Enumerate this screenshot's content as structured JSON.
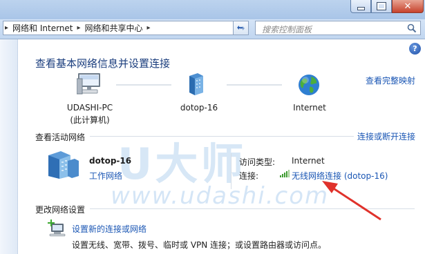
{
  "address_bar": {
    "crumbs": [
      "网络和 Internet",
      "网络和共享中心"
    ]
  },
  "search": {
    "placeholder": "搜索控制面板"
  },
  "help_label": "?",
  "page_title": "查看基本网络信息并设置连接",
  "view_full_map": "查看完整映射",
  "network_map": {
    "computer": {
      "name": "UDASHI-PC",
      "sub": "(此计算机)"
    },
    "network": {
      "name": "dotop-16"
    },
    "internet": {
      "name": "Internet"
    }
  },
  "active_networks": {
    "heading": "查看活动网络",
    "connect_link": "连接或断开连接",
    "network_name": "dotop-16",
    "network_type": "工作网络",
    "access_type_label": "访问类型:",
    "access_type_value": "Internet",
    "connections_label": "连接:",
    "connection_value": "无线网络连接 (dotop-16)"
  },
  "change_settings": {
    "heading": "更改网络设置",
    "task_link": "设置新的连接或网络",
    "task_desc": "设置无线、宽带、拨号、临时或 VPN 连接；或设置路由器或访问点。"
  },
  "watermark": {
    "brand": "U大师",
    "url": "www.udashi.com"
  },
  "colors": {
    "link": "#1a56b4",
    "title": "#1a3d7d",
    "arrow": "#e0322b"
  }
}
